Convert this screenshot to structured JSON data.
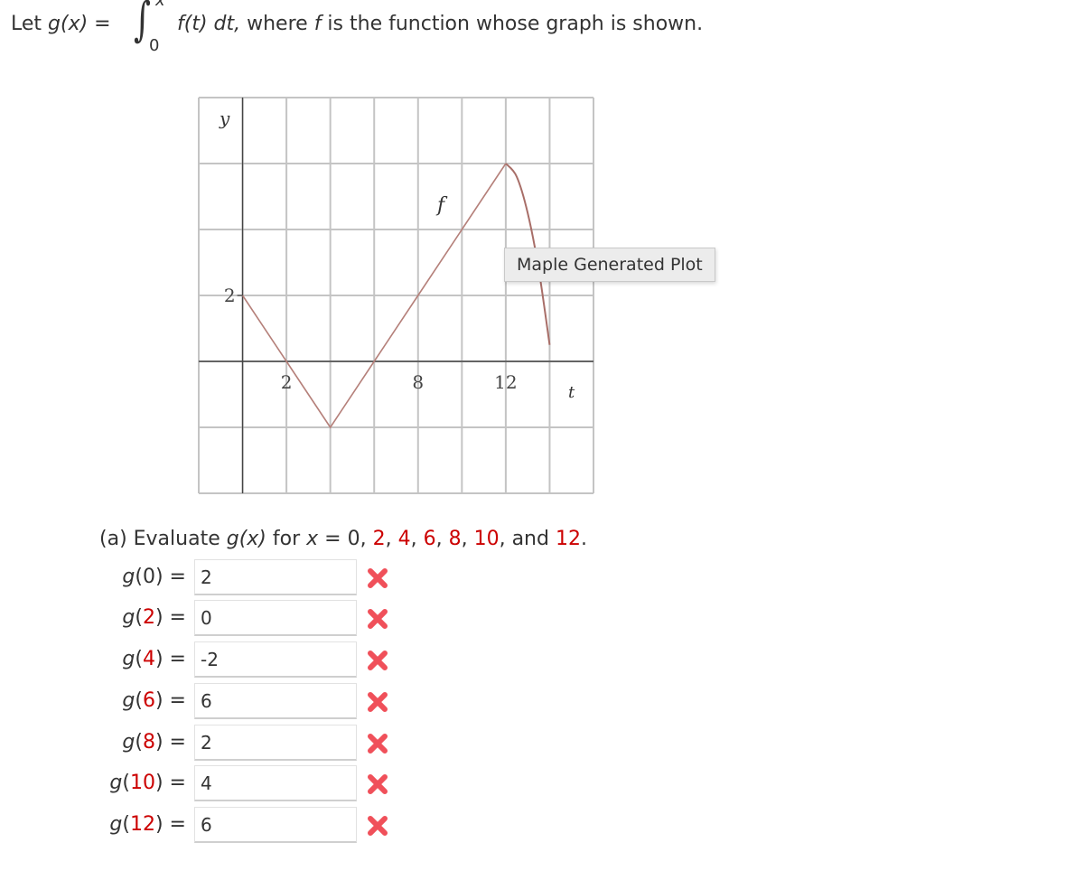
{
  "prompt": {
    "lead": "Let ",
    "g_func": "g",
    "g_arg": "(x)",
    "equals": " = ",
    "integral_upper": "x",
    "integral_lower": "0",
    "integrand": "f(t) dt,",
    "rest_1": " where ",
    "f_name": "f",
    "rest_2": " is the function whose graph is shown."
  },
  "graph": {
    "tooltip": "Maple Generated Plot",
    "curve_color": "#b5807a"
  },
  "chart_data": {
    "type": "line",
    "title": "",
    "xlabel": "t",
    "ylabel": "y",
    "curve_label": "f",
    "x_tick_labels": [
      "2",
      "8",
      "12"
    ],
    "x_tick_values": [
      2,
      8,
      12
    ],
    "y_tick_labels": [
      "2"
    ],
    "y_tick_values": [
      2
    ],
    "xlim": [
      -2,
      16
    ],
    "ylim": [
      -4,
      8
    ],
    "grid": true,
    "grid_step_x": 2,
    "grid_step_y": 2,
    "series": [
      {
        "name": "f",
        "segments": [
          {
            "kind": "line",
            "points": [
              [
                0,
                2
              ],
              [
                2,
                0
              ],
              [
                4,
                -2
              ],
              [
                6,
                0
              ],
              [
                8,
                2
              ],
              [
                10,
                4
              ],
              [
                12,
                6
              ]
            ]
          },
          {
            "kind": "curve",
            "points": [
              [
                12,
                6
              ],
              [
                12.5,
                5.6
              ],
              [
                13,
                4.5
              ],
              [
                13.5,
                2.8
              ],
              [
                14,
                0.5
              ]
            ]
          }
        ]
      }
    ]
  },
  "question": {
    "lead": "(a) Evaluate ",
    "g": "g",
    "gx": "(x)",
    "for": " for ",
    "x": "x",
    "eq": " = 0, ",
    "vals": [
      "2",
      "4",
      "6",
      "8",
      "10"
    ],
    "and": "and ",
    "last": "12",
    "end": "."
  },
  "answers": [
    {
      "arg": "0",
      "arg_red": false,
      "value": "2",
      "status": "incorrect"
    },
    {
      "arg": "2",
      "arg_red": true,
      "value": "0",
      "status": "incorrect"
    },
    {
      "arg": "4",
      "arg_red": true,
      "value": "-2",
      "status": "incorrect"
    },
    {
      "arg": "6",
      "arg_red": true,
      "value": "6",
      "status": "incorrect"
    },
    {
      "arg": "8",
      "arg_red": true,
      "value": "2",
      "status": "incorrect"
    },
    {
      "arg": "10",
      "arg_red": true,
      "value": "4",
      "status": "incorrect"
    },
    {
      "arg": "12",
      "arg_red": true,
      "value": "6",
      "status": "incorrect"
    }
  ],
  "colors": {
    "accent_red": "#cc0000",
    "incorrect_mark": "#f0505a"
  }
}
